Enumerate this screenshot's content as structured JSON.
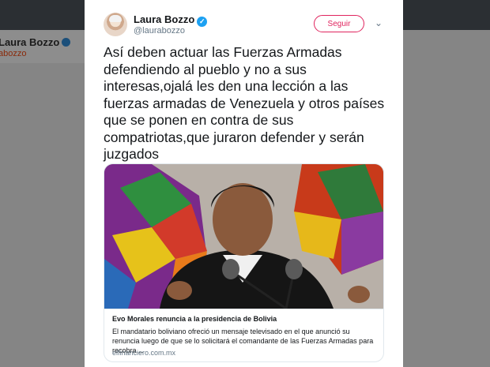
{
  "background": {
    "profile_name": "Laura Bozzo",
    "profile_handle": "abozzo"
  },
  "tweet": {
    "author_name": "Laura Bozzo",
    "author_handle": "@laurabozzo",
    "verified": true,
    "follow_label": "Seguir",
    "text_lines": [
      "Así deben actuar las Fuerzas Armadas",
      "defendiendo al pueblo y no a sus",
      "interesas,ojalá les den una lección a las",
      "fuerzas armadas de Venezuela y otros países",
      "que se ponen en contra de sus",
      "compatriotas,que juraron defender y serán",
      "juzgados"
    ]
  },
  "link_card": {
    "title": "Evo Morales renuncia a la presidencia de Bolivia",
    "description": "El mandatario boliviano ofreció un mensaje televisado en el que anunció su renuncia luego de que se lo solicitará el comandante de las Fuerzas Armadas para recobra…",
    "domain": "elfinanciero.com.mx"
  },
  "icons": {
    "verified": "verified-badge-icon",
    "caret": "chevron-down-icon"
  },
  "colors": {
    "follow_accent": "#e0245e",
    "verified_blue": "#1da1f2",
    "text": "#14171a",
    "muted": "#657786"
  }
}
